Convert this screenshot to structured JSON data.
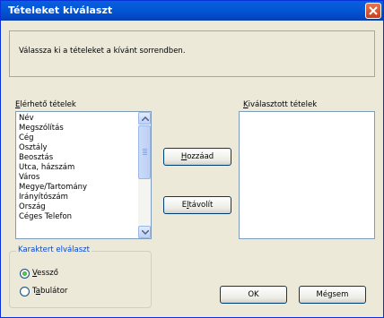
{
  "title": "Tételeket kiválaszt",
  "instruction": "Válassza ki a tételeket a kívánt sorrendben.",
  "available": {
    "label_first": "E",
    "label_rest": "lérhető tételek",
    "items": [
      "Név",
      "Megszólítás",
      "Cég",
      "Osztály",
      "Beosztás",
      "Utca, házszám",
      "Város",
      "Megye/Tartomány",
      "Irányítószám",
      "Ország",
      "Céges Telefon"
    ]
  },
  "selected": {
    "label_first": "K",
    "label_rest": "iválasztott tételek"
  },
  "buttons": {
    "add_first": "H",
    "add_rest": "ozzáad",
    "remove_pre": "E",
    "remove_u": "l",
    "remove_rest": "távolít",
    "ok": "OK",
    "cancel": "Mégsem"
  },
  "separator": {
    "legend": "Karaktert elválaszt",
    "comma_first": "V",
    "comma_rest": "essző",
    "tab_pre": "T",
    "tab_u": "a",
    "tab_rest": "bulátor",
    "selected": "comma"
  },
  "icons": [
    "close-icon",
    "scroll-up-icon",
    "scroll-down-icon"
  ]
}
